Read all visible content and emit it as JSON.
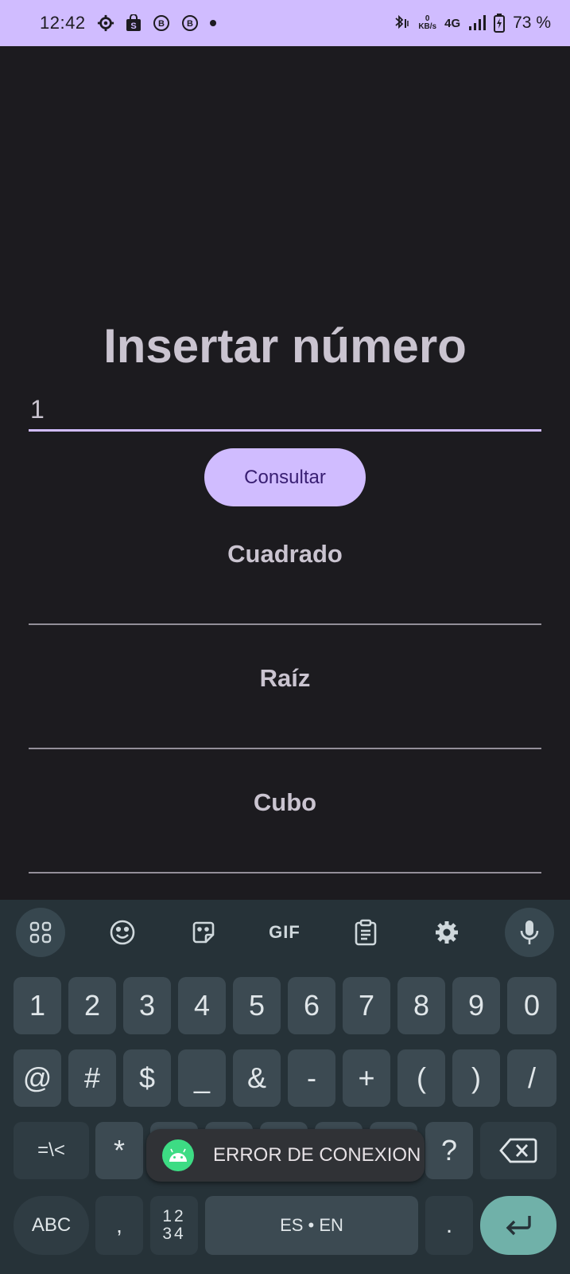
{
  "statusbar": {
    "time": "12:42",
    "icons_left": [
      "settings-gear-icon",
      "shopping-bag-icon",
      "b-circle-icon",
      "b-circle-icon",
      "dot-icon"
    ],
    "net_speed_value": "0",
    "net_speed_unit": "KB/s",
    "network": "4G",
    "battery": "73 %"
  },
  "main": {
    "title": "Insertar número",
    "input_value": "1",
    "button_label": "Consultar",
    "results": [
      {
        "label": "Cuadrado",
        "value": ""
      },
      {
        "label": "Raíz",
        "value": ""
      },
      {
        "label": "Cubo",
        "value": ""
      }
    ]
  },
  "keyboard": {
    "toolbar": [
      "apps-grid-icon",
      "emoji-icon",
      "sticker-icon",
      "gif-icon",
      "clipboard-icon",
      "settings-icon",
      "mic-icon"
    ],
    "gif_label": "GIF",
    "row1": [
      "1",
      "2",
      "3",
      "4",
      "5",
      "6",
      "7",
      "8",
      "9",
      "0"
    ],
    "row2": [
      "@",
      "#",
      "$",
      "_",
      "&",
      "-",
      "+",
      "(",
      ")",
      "/"
    ],
    "row3": [
      "=\\<",
      "*",
      "\"",
      "'",
      ":",
      ";",
      "!",
      "?"
    ],
    "bottom": {
      "abc": "ABC",
      "comma": ",",
      "numpad_top": "12",
      "numpad_bottom": "34",
      "space": "ES • EN",
      "period": "."
    }
  },
  "toast": {
    "text": "ERROR DE CONEXION"
  },
  "colors": {
    "accent": "#d0bcff",
    "background": "#1c1b1f",
    "keyboard": "#263238",
    "enter": "#70b1a9"
  }
}
